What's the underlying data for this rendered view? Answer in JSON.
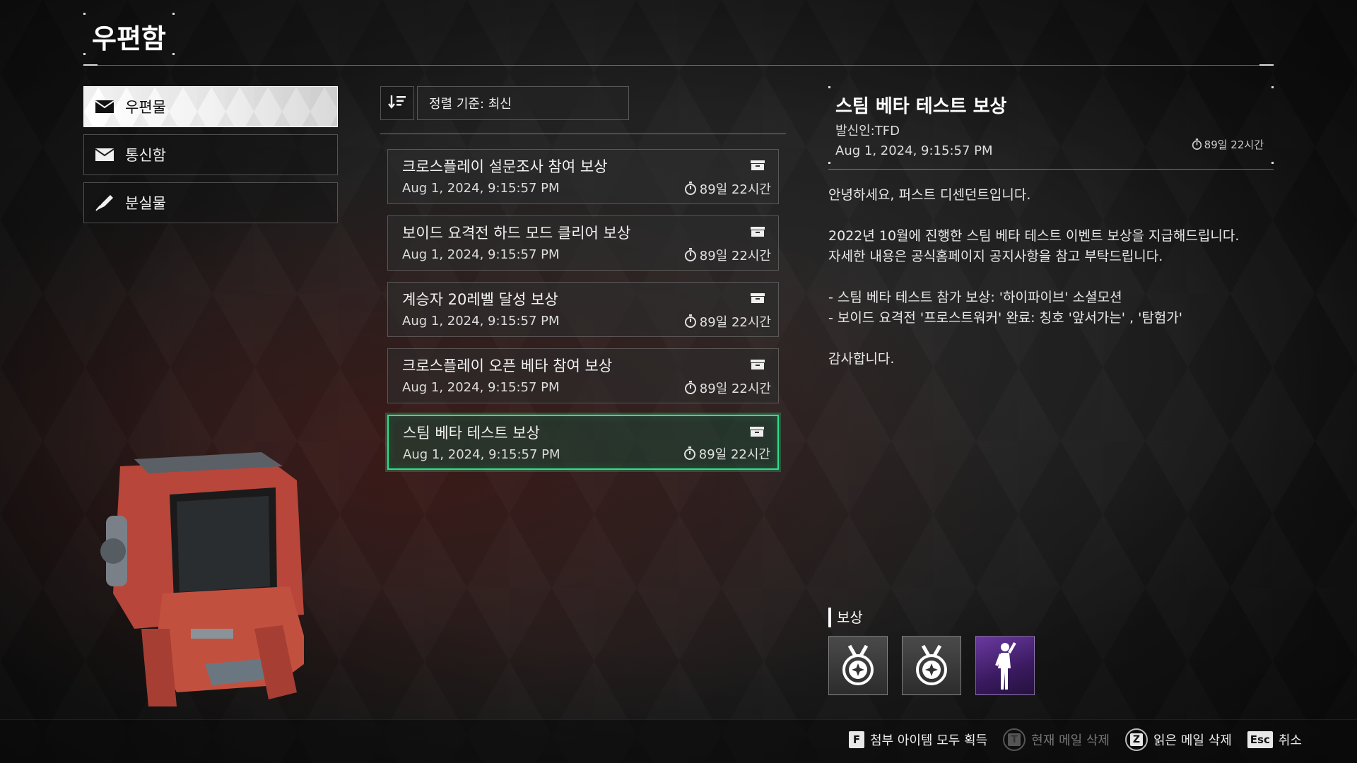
{
  "header": {
    "title": "우편함"
  },
  "nav": {
    "items": [
      {
        "label": "우편물",
        "icon": "envelope-icon",
        "active": true
      },
      {
        "label": "통신함",
        "icon": "envelope-icon",
        "active": false
      },
      {
        "label": "분실물",
        "icon": "pen-icon",
        "active": false
      }
    ]
  },
  "sort": {
    "label": "정렬 기준: 최신",
    "icon": "sort-descending-icon"
  },
  "mails": [
    {
      "title": "크로스플레이 설문조사 참여 보상",
      "date": "Aug 1, 2024, 9:15:57 PM",
      "expire": "89일 22시간"
    },
    {
      "title": "보이드 요격전 하드 모드 클리어 보상",
      "date": "Aug 1, 2024, 9:15:57 PM",
      "expire": "89일 22시간"
    },
    {
      "title": "계승자 20레벨 달성 보상",
      "date": "Aug 1, 2024, 9:15:57 PM",
      "expire": "89일 22시간"
    },
    {
      "title": "크로스플레이 오픈 베타 참여 보상",
      "date": "Aug 1, 2024, 9:15:57 PM",
      "expire": "89일 22시간"
    },
    {
      "title": "스팀 베타 테스트 보상",
      "date": "Aug 1, 2024, 9:15:57 PM",
      "expire": "89일 22시간",
      "selected": true
    }
  ],
  "detail": {
    "title": "스팀 베타 테스트 보상",
    "sender": "발신인:TFD",
    "date": "Aug 1, 2024, 9:15:57 PM",
    "expire": "89일 22시간",
    "body": [
      "안녕하세요, 퍼스트 디센던트입니다.",
      "",
      "2022년 10월에 진행한 스팀 베타 테스트 이벤트 보상을 지급해드립니다.",
      "자세한 내용은 공식홈페이지 공지사항을 참고 부탁드립니다.",
      "",
      "- 스팀 베타 테스트 참가 보상: '하이파이브' 소셜모션",
      "- 보이드 요격전 '프로스트워커' 완료: 칭호 '앞서가는' , '탐험가'",
      "",
      "감사합니다."
    ]
  },
  "rewards": {
    "label": "보상",
    "items": [
      {
        "icon": "title-medal-icon",
        "rarity": "normal"
      },
      {
        "icon": "title-medal-icon",
        "rarity": "normal"
      },
      {
        "icon": "social-motion-figure-icon",
        "rarity": "purple"
      }
    ]
  },
  "footer": {
    "hints": [
      {
        "key": "F",
        "label": "첨부 아이템 모두 획득",
        "enabled": true,
        "round": false
      },
      {
        "key": "T",
        "label": "현재 메일 삭제",
        "enabled": false,
        "round": true
      },
      {
        "key": "Z",
        "label": "읽은 메일 삭제",
        "enabled": true,
        "round": true
      },
      {
        "key": "Esc",
        "label": "취소",
        "enabled": true,
        "round": false
      }
    ]
  },
  "colors": {
    "accent": "#2ee08a",
    "selected_bg": "#1e4634",
    "reward_purple": "#6a3aa0"
  }
}
